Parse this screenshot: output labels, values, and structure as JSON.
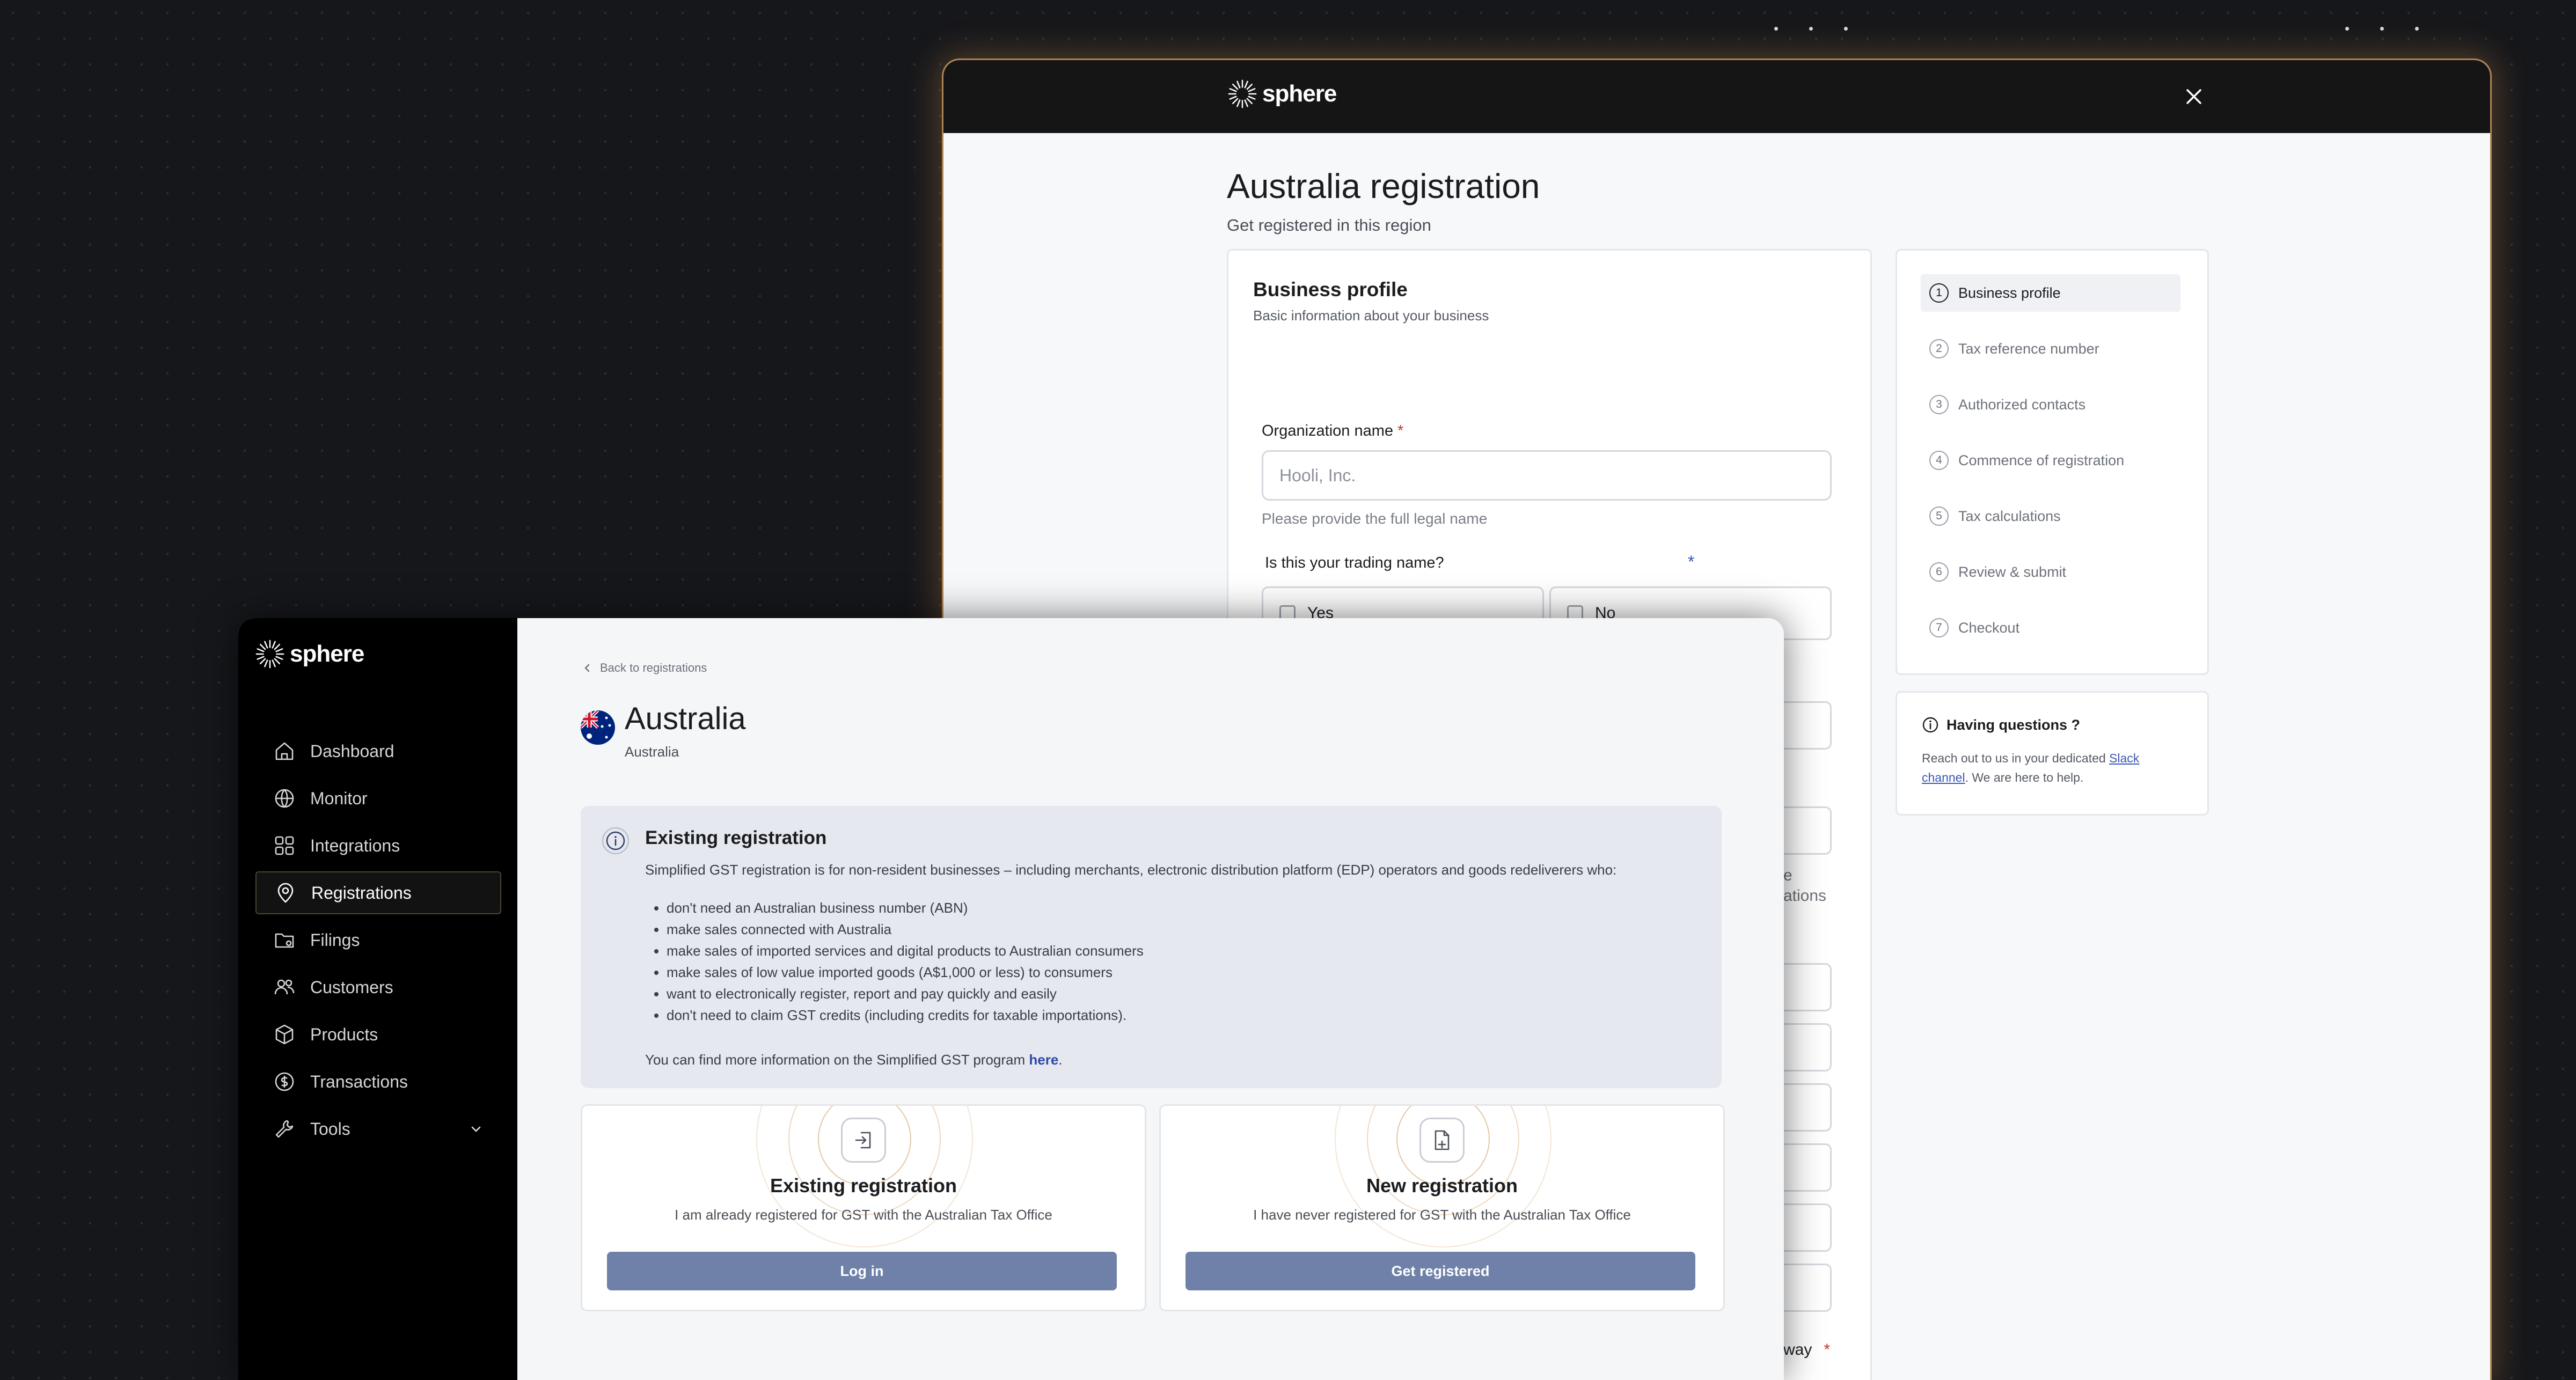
{
  "brand": {
    "name": "sphere"
  },
  "wizard": {
    "title": "Australia registration",
    "subtitle": "Get registered in this region",
    "section": {
      "title": "Business profile",
      "subtitle": "Basic information about your business"
    },
    "org_name": {
      "label": "Organization name",
      "required_mark": "*",
      "placeholder": "Hooli, Inc.",
      "value": "",
      "hint": "Please provide the full legal name"
    },
    "trading_name": {
      "question": "Is this your trading name?",
      "required_mark": "*",
      "options": [
        "Yes",
        "No"
      ]
    },
    "partial_text": {
      "e": "e",
      "ations": "ations",
      "way": "way",
      "req": "*"
    },
    "steps": [
      {
        "num": "1",
        "label": "Business profile",
        "active": true
      },
      {
        "num": "2",
        "label": "Tax reference number"
      },
      {
        "num": "3",
        "label": "Authorized contacts"
      },
      {
        "num": "4",
        "label": "Commence of registration"
      },
      {
        "num": "5",
        "label": "Tax calculations"
      },
      {
        "num": "6",
        "label": "Review & submit"
      },
      {
        "num": "7",
        "label": "Checkout"
      }
    ],
    "help": {
      "title": "Having questions ?",
      "body_pre": "Reach out to us in your dedicated ",
      "link": "Slack channel",
      "body_post": ". We are here to help."
    }
  },
  "sidebar": {
    "items": [
      {
        "label": "Dashboard",
        "icon": "home-icon"
      },
      {
        "label": "Monitor",
        "icon": "globe-icon"
      },
      {
        "label": "Integrations",
        "icon": "grid-icon"
      },
      {
        "label": "Registrations",
        "icon": "location-pin-icon",
        "active": true
      },
      {
        "label": "Filings",
        "icon": "folder-icon"
      },
      {
        "label": "Customers",
        "icon": "users-icon"
      },
      {
        "label": "Products",
        "icon": "box-icon"
      },
      {
        "label": "Transactions",
        "icon": "dollar-circle-icon"
      },
      {
        "label": "Tools",
        "icon": "wrench-icon"
      }
    ]
  },
  "page": {
    "back_link": "Back to registrations",
    "country": "Australia",
    "country_sub": "Australia"
  },
  "info": {
    "title": "Existing registration",
    "description": "Simplified GST registration is for non-resident businesses – including merchants, electronic distribution platform (EDP) operators and goods redeliverers who:",
    "bullets": [
      "don't need an Australian business number (ABN)",
      "make sales connected with Australia",
      "make sales of imported services and digital products to Australian consumers",
      "make sales of low value imported goods (A$1,000 or less) to consumers",
      "want to electronically register, report and pay quickly and easily",
      "don't need to claim GST credits (including credits for taxable importations)."
    ],
    "footer_pre": "You can find more information on the Simplified GST program ",
    "footer_link": "here",
    "footer_post": "."
  },
  "options": [
    {
      "title": "Existing registration",
      "desc": "I am already registered for GST with the Australian Tax Office",
      "button": "Log in",
      "icon": "login-icon"
    },
    {
      "title": "New registration",
      "desc": "I have never registered for GST with the Australian Tax Office",
      "button": "Get registered",
      "icon": "document-icon"
    }
  ],
  "colors": {
    "accent_button": "#6f81a9",
    "link": "#2f48a8",
    "info_bg": "#e5e8ef",
    "window_glow": "#d6a060"
  }
}
